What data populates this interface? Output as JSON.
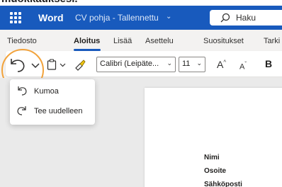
{
  "clipped_heading": "muokkauksesi.",
  "titlebar": {
    "app_name": "Word",
    "doc_title": "CV pohja - Tallennettu",
    "title_chevron": "⌄",
    "search_placeholder": "Haku",
    "brand_color": "#185abd"
  },
  "tabs": [
    {
      "label": "Tiedosto"
    },
    {
      "label": "Aloitus",
      "active": true
    },
    {
      "label": "Lisää"
    },
    {
      "label": "Asettelu"
    },
    {
      "label": "Suositukset"
    },
    {
      "label": "Tarki"
    }
  ],
  "ribbon": {
    "font_name": "Calibri (Leipäte...",
    "font_size": "11",
    "grow_font": "A",
    "shrink_font": "A",
    "bold": "B",
    "highlight_color": "#f2a33c"
  },
  "undo_menu": {
    "items": [
      {
        "label": "Kumoa",
        "icon": "undo-icon"
      },
      {
        "label": "Tee uudelleen",
        "icon": "redo-icon"
      }
    ]
  },
  "document": {
    "lines": [
      "Nimi",
      "Osoite",
      "Sähköposti"
    ]
  }
}
